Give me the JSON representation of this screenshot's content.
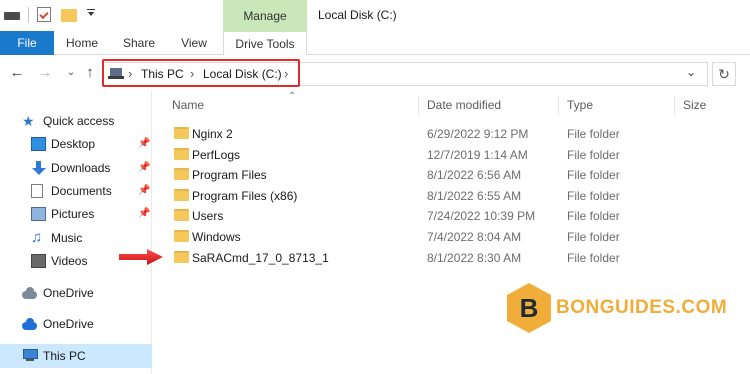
{
  "window": {
    "title": "Local Disk (C:)",
    "manage_label": "Manage"
  },
  "ribbon": {
    "tabs": [
      "File",
      "Home",
      "Share",
      "View",
      "Drive Tools"
    ]
  },
  "address": {
    "crumbs": [
      "This PC",
      "Local Disk (C:)"
    ],
    "highlight_color": "#e12a2a"
  },
  "sidebar": {
    "items": [
      {
        "label": "Quick access",
        "icon": "star-icon",
        "pinned": false
      },
      {
        "label": "Desktop",
        "icon": "desktop-icon",
        "pinned": true
      },
      {
        "label": "Downloads",
        "icon": "download-icon",
        "pinned": true
      },
      {
        "label": "Documents",
        "icon": "documents-icon",
        "pinned": true
      },
      {
        "label": "Pictures",
        "icon": "pictures-icon",
        "pinned": true
      },
      {
        "label": "Music",
        "icon": "music-icon",
        "pinned": false
      },
      {
        "label": "Videos",
        "icon": "videos-icon",
        "pinned": false
      },
      {
        "label": "OneDrive",
        "icon": "onedrive-icon",
        "pinned": false
      },
      {
        "label": "OneDrive",
        "icon": "onedrive-icon",
        "pinned": false
      },
      {
        "label": "This PC",
        "icon": "this-pc-icon",
        "pinned": false,
        "selected": true
      }
    ]
  },
  "columns": {
    "name": "Name",
    "date": "Date modified",
    "type": "Type",
    "size": "Size"
  },
  "files": [
    {
      "name": "Nginx 2",
      "date": "6/29/2022 9:12 PM",
      "type": "File folder"
    },
    {
      "name": "PerfLogs",
      "date": "12/7/2019 1:14 AM",
      "type": "File folder"
    },
    {
      "name": "Program Files",
      "date": "8/1/2022 6:56 AM",
      "type": "File folder"
    },
    {
      "name": "Program Files (x86)",
      "date": "8/1/2022 6:55 AM",
      "type": "File folder"
    },
    {
      "name": "Users",
      "date": "7/24/2022 10:39 PM",
      "type": "File folder"
    },
    {
      "name": "Windows",
      "date": "7/4/2022 8:04 AM",
      "type": "File folder"
    },
    {
      "name": "SaRACmd_17_0_8713_1",
      "date": "8/1/2022 8:30 AM",
      "type": "File folder"
    }
  ],
  "watermark": {
    "letter": "B",
    "text": "BONGUIDES.COM",
    "color": "#f0ad3a"
  }
}
